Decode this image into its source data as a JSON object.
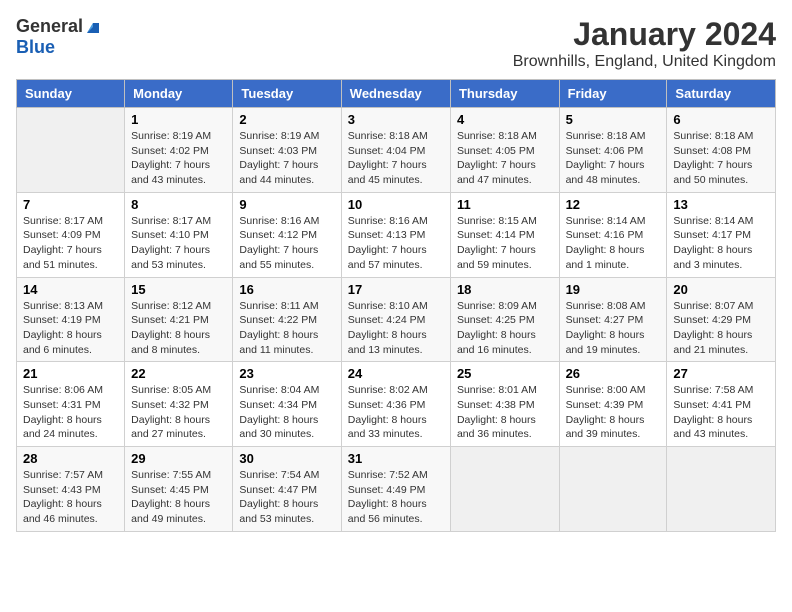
{
  "header": {
    "logo_general": "General",
    "logo_blue": "Blue",
    "title": "January 2024",
    "subtitle": "Brownhills, England, United Kingdom"
  },
  "days_of_week": [
    "Sunday",
    "Monday",
    "Tuesday",
    "Wednesday",
    "Thursday",
    "Friday",
    "Saturday"
  ],
  "weeks": [
    [
      {
        "day": "",
        "sunrise": "",
        "sunset": "",
        "daylight": ""
      },
      {
        "day": "1",
        "sunrise": "Sunrise: 8:19 AM",
        "sunset": "Sunset: 4:02 PM",
        "daylight": "Daylight: 7 hours and 43 minutes."
      },
      {
        "day": "2",
        "sunrise": "Sunrise: 8:19 AM",
        "sunset": "Sunset: 4:03 PM",
        "daylight": "Daylight: 7 hours and 44 minutes."
      },
      {
        "day": "3",
        "sunrise": "Sunrise: 8:18 AM",
        "sunset": "Sunset: 4:04 PM",
        "daylight": "Daylight: 7 hours and 45 minutes."
      },
      {
        "day": "4",
        "sunrise": "Sunrise: 8:18 AM",
        "sunset": "Sunset: 4:05 PM",
        "daylight": "Daylight: 7 hours and 47 minutes."
      },
      {
        "day": "5",
        "sunrise": "Sunrise: 8:18 AM",
        "sunset": "Sunset: 4:06 PM",
        "daylight": "Daylight: 7 hours and 48 minutes."
      },
      {
        "day": "6",
        "sunrise": "Sunrise: 8:18 AM",
        "sunset": "Sunset: 4:08 PM",
        "daylight": "Daylight: 7 hours and 50 minutes."
      }
    ],
    [
      {
        "day": "7",
        "sunrise": "Sunrise: 8:17 AM",
        "sunset": "Sunset: 4:09 PM",
        "daylight": "Daylight: 7 hours and 51 minutes."
      },
      {
        "day": "8",
        "sunrise": "Sunrise: 8:17 AM",
        "sunset": "Sunset: 4:10 PM",
        "daylight": "Daylight: 7 hours and 53 minutes."
      },
      {
        "day": "9",
        "sunrise": "Sunrise: 8:16 AM",
        "sunset": "Sunset: 4:12 PM",
        "daylight": "Daylight: 7 hours and 55 minutes."
      },
      {
        "day": "10",
        "sunrise": "Sunrise: 8:16 AM",
        "sunset": "Sunset: 4:13 PM",
        "daylight": "Daylight: 7 hours and 57 minutes."
      },
      {
        "day": "11",
        "sunrise": "Sunrise: 8:15 AM",
        "sunset": "Sunset: 4:14 PM",
        "daylight": "Daylight: 7 hours and 59 minutes."
      },
      {
        "day": "12",
        "sunrise": "Sunrise: 8:14 AM",
        "sunset": "Sunset: 4:16 PM",
        "daylight": "Daylight: 8 hours and 1 minute."
      },
      {
        "day": "13",
        "sunrise": "Sunrise: 8:14 AM",
        "sunset": "Sunset: 4:17 PM",
        "daylight": "Daylight: 8 hours and 3 minutes."
      }
    ],
    [
      {
        "day": "14",
        "sunrise": "Sunrise: 8:13 AM",
        "sunset": "Sunset: 4:19 PM",
        "daylight": "Daylight: 8 hours and 6 minutes."
      },
      {
        "day": "15",
        "sunrise": "Sunrise: 8:12 AM",
        "sunset": "Sunset: 4:21 PM",
        "daylight": "Daylight: 8 hours and 8 minutes."
      },
      {
        "day": "16",
        "sunrise": "Sunrise: 8:11 AM",
        "sunset": "Sunset: 4:22 PM",
        "daylight": "Daylight: 8 hours and 11 minutes."
      },
      {
        "day": "17",
        "sunrise": "Sunrise: 8:10 AM",
        "sunset": "Sunset: 4:24 PM",
        "daylight": "Daylight: 8 hours and 13 minutes."
      },
      {
        "day": "18",
        "sunrise": "Sunrise: 8:09 AM",
        "sunset": "Sunset: 4:25 PM",
        "daylight": "Daylight: 8 hours and 16 minutes."
      },
      {
        "day": "19",
        "sunrise": "Sunrise: 8:08 AM",
        "sunset": "Sunset: 4:27 PM",
        "daylight": "Daylight: 8 hours and 19 minutes."
      },
      {
        "day": "20",
        "sunrise": "Sunrise: 8:07 AM",
        "sunset": "Sunset: 4:29 PM",
        "daylight": "Daylight: 8 hours and 21 minutes."
      }
    ],
    [
      {
        "day": "21",
        "sunrise": "Sunrise: 8:06 AM",
        "sunset": "Sunset: 4:31 PM",
        "daylight": "Daylight: 8 hours and 24 minutes."
      },
      {
        "day": "22",
        "sunrise": "Sunrise: 8:05 AM",
        "sunset": "Sunset: 4:32 PM",
        "daylight": "Daylight: 8 hours and 27 minutes."
      },
      {
        "day": "23",
        "sunrise": "Sunrise: 8:04 AM",
        "sunset": "Sunset: 4:34 PM",
        "daylight": "Daylight: 8 hours and 30 minutes."
      },
      {
        "day": "24",
        "sunrise": "Sunrise: 8:02 AM",
        "sunset": "Sunset: 4:36 PM",
        "daylight": "Daylight: 8 hours and 33 minutes."
      },
      {
        "day": "25",
        "sunrise": "Sunrise: 8:01 AM",
        "sunset": "Sunset: 4:38 PM",
        "daylight": "Daylight: 8 hours and 36 minutes."
      },
      {
        "day": "26",
        "sunrise": "Sunrise: 8:00 AM",
        "sunset": "Sunset: 4:39 PM",
        "daylight": "Daylight: 8 hours and 39 minutes."
      },
      {
        "day": "27",
        "sunrise": "Sunrise: 7:58 AM",
        "sunset": "Sunset: 4:41 PM",
        "daylight": "Daylight: 8 hours and 43 minutes."
      }
    ],
    [
      {
        "day": "28",
        "sunrise": "Sunrise: 7:57 AM",
        "sunset": "Sunset: 4:43 PM",
        "daylight": "Daylight: 8 hours and 46 minutes."
      },
      {
        "day": "29",
        "sunrise": "Sunrise: 7:55 AM",
        "sunset": "Sunset: 4:45 PM",
        "daylight": "Daylight: 8 hours and 49 minutes."
      },
      {
        "day": "30",
        "sunrise": "Sunrise: 7:54 AM",
        "sunset": "Sunset: 4:47 PM",
        "daylight": "Daylight: 8 hours and 53 minutes."
      },
      {
        "day": "31",
        "sunrise": "Sunrise: 7:52 AM",
        "sunset": "Sunset: 4:49 PM",
        "daylight": "Daylight: 8 hours and 56 minutes."
      },
      {
        "day": "",
        "sunrise": "",
        "sunset": "",
        "daylight": ""
      },
      {
        "day": "",
        "sunrise": "",
        "sunset": "",
        "daylight": ""
      },
      {
        "day": "",
        "sunrise": "",
        "sunset": "",
        "daylight": ""
      }
    ]
  ]
}
